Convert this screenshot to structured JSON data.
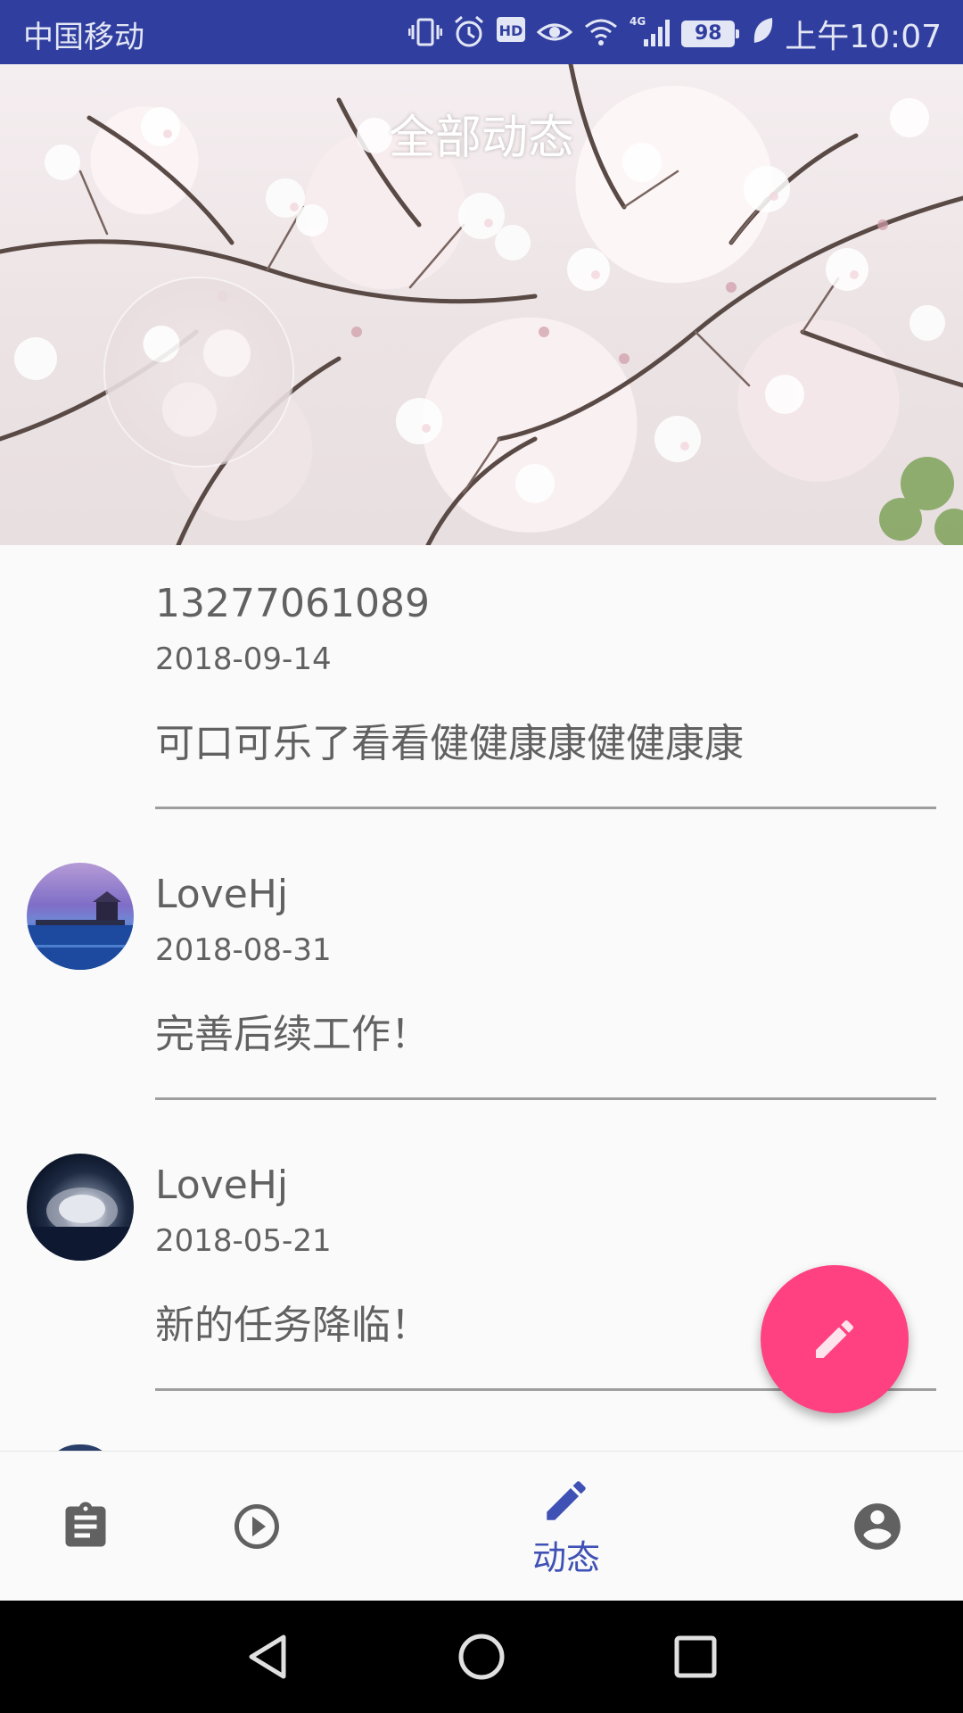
{
  "status_bar": {
    "carrier": "中国移动",
    "network": "4G",
    "battery": "98",
    "time": "上午10:07",
    "icons": [
      "vibrate-icon",
      "alarm-icon",
      "hd-icon",
      "eye-icon",
      "wifi-icon",
      "signal-icon",
      "battery-icon",
      "leaf-icon"
    ]
  },
  "header": {
    "title": "全部动态"
  },
  "feed": [
    {
      "name": "13277061089",
      "date": "2018-09-14",
      "content": "可口可乐了看看健健康康健健康康"
    },
    {
      "name": "LoveHj",
      "date": "2018-08-31",
      "content": "完善后续工作！"
    },
    {
      "name": "LoveHj",
      "date": "2018-05-21",
      "content": "新的任务降临！"
    }
  ],
  "fab": {
    "icon": "pencil-icon"
  },
  "bottom_nav": {
    "items": [
      {
        "icon": "clipboard-icon",
        "label": ""
      },
      {
        "icon": "play-circle-icon",
        "label": ""
      },
      {
        "icon": "pencil-icon",
        "label": "动态",
        "active": true
      },
      {
        "icon": "account-circle-icon",
        "label": ""
      }
    ],
    "active_color": "#3f51b5",
    "inactive_color": "#616161"
  },
  "system_nav": {
    "icons": [
      "back-icon",
      "home-icon",
      "recents-icon"
    ]
  },
  "colors": {
    "primary_dark": "#303f9f",
    "accent": "#ff4081",
    "background": "#fafafa"
  }
}
